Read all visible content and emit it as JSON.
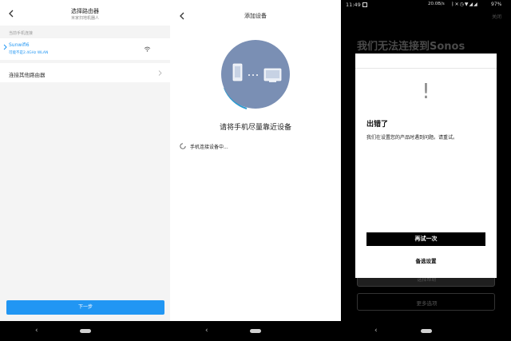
{
  "screen1": {
    "title": "选择路由器",
    "subtitle": "米家扫地机器人",
    "section_label": "当前手机连接",
    "current_wifi": {
      "name": "Sunwifi6",
      "note": "可能不是2.4GHz WLAN"
    },
    "other_router_label": "连接其他路由器",
    "next_button_label": "下一步",
    "accent_color": "#2196f3"
  },
  "screen2": {
    "title": "添加设备",
    "instruction": "请将手机尽量靠近设备",
    "status_text": "手机连接设备中...",
    "illustration_color": "#7a8fb4"
  },
  "screen3": {
    "status_bar": {
      "time": "11:49",
      "network_speed": "20.0B/s",
      "battery": "97%"
    },
    "close_label": "关闭",
    "background_title": "我们无法连接到Sonos",
    "background_button_1": "选择帮助",
    "background_button_2": "更多选项",
    "dialog": {
      "icon": "exclamation-icon",
      "title": "出错了",
      "message": "我们在设置您的产品时遇到问题。请重试。",
      "retry_label": "再试一次",
      "alternate_label": "备选设置"
    }
  },
  "nav": {
    "back_glyph": "‹"
  }
}
